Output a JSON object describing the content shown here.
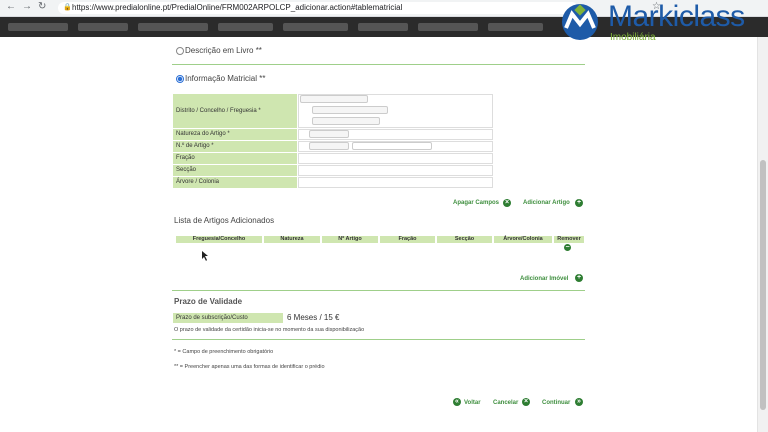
{
  "browser": {
    "url": "https://www.predialonline.pt/PredialOnline/FRM002ARPOLCP_adicionar.action#tablematricial"
  },
  "logo": {
    "brand": "Markiclass",
    "sub": "Imobiliária"
  },
  "form": {
    "option_descricao": "Descrição em Livro **",
    "option_matricial": "Informação Matricial **",
    "fields": {
      "distrito": "Distrito / Concelho / Freguesia *",
      "natureza": "Natureza do Artigo *",
      "numero": "N.º de Artigo *",
      "fracao": "Fração",
      "seccao": "Secção",
      "arvore": "Árvore / Colonia"
    },
    "apagar": "Apagar Campos",
    "adicionar_artigo": "Adicionar Artigo"
  },
  "artigos": {
    "title": "Lista de Artigos Adicionados",
    "headers": [
      "Freguesia/Concelho",
      "Natureza",
      "Nº Artigo",
      "Fração",
      "Secção",
      "Árvore/Colonia",
      "Remover"
    ],
    "row": [
      "",
      "",
      "",
      "",
      "",
      "",
      ""
    ],
    "adicionar_imovel": "Adicionar Imóvel"
  },
  "prazo": {
    "title": "Prazo de Validade",
    "label": "Prazo de subscrição/Custo",
    "value": "6 Meses / 15 €",
    "note": "O prazo de validade da certidão inicia-se no momento da sua disponibilização"
  },
  "notes": {
    "required": "* = Campo de preenchimento obrigatório",
    "either": "** = Preencher apenas uma das formas de identificar o prédio"
  },
  "footer": {
    "voltar": "Voltar",
    "cancelar": "Cancelar",
    "continuar": "Continuar"
  },
  "colors": {
    "accent_green": "#2e7d32",
    "label_bg": "#cfe6b0",
    "link": "#3f8f3f",
    "brand_blue": "#1e5ba8"
  }
}
